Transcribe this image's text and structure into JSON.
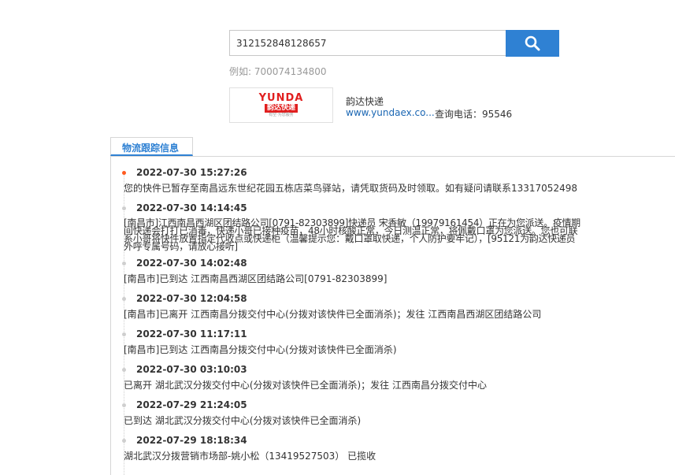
{
  "search": {
    "value": "312152848128657",
    "example_label": "例如:",
    "example_value": "700074134800"
  },
  "company": {
    "logo_text": "YUNDA",
    "logo_sub": "韵达快递",
    "logo_slogan": "有空·为您服务",
    "name": "韵达快递",
    "site": "www.yundaex.co...",
    "phone": "查询电话：95546"
  },
  "tab": {
    "label": "物流跟踪信息"
  },
  "colors": {
    "accent": "#2f81d3",
    "first_dot": "#ff5a1f"
  },
  "tracking": [
    {
      "time": "2022-07-30 15:27:26",
      "context": "您的快件已暂存至南昌远东世纪花园五栋店菜鸟驿站，请凭取货码及时领取。如有疑问请联系13317052498"
    },
    {
      "time": "2022-07-30 14:14:45",
      "context": "[南昌市]江西南昌西湖区团结路公司[0791-82303899]快递员 宋香敏（19979161454）正在为您派送。疫情期间快递会打打已消毒，快递小哥已接种疫苗，48小时核酸正常，今日测温正常，将佩戴口罩为您派送。您也可联系小哥将快件放置指定代收点或快递柜（温馨提示您：戴口罩取快递，个人防护要牢记），[95121为韵达快递员外呼专属号码，请放心接听]"
    },
    {
      "time": "2022-07-30 14:02:48",
      "context": "[南昌市]已到达 江西南昌西湖区团结路公司[0791-82303899]"
    },
    {
      "time": "2022-07-30 12:04:58",
      "context": "[南昌市]已离开 江西南昌分拨交付中心(分拨对该快件已全面消杀)；发往 江西南昌西湖区团结路公司"
    },
    {
      "time": "2022-07-30 11:17:11",
      "context": "[南昌市]已到达 江西南昌分拨交付中心(分拨对该快件已全面消杀)"
    },
    {
      "time": "2022-07-30 03:10:03",
      "context": "已离开 湖北武汉分拨交付中心(分拨对该快件已全面消杀)；发往 江西南昌分拨交付中心"
    },
    {
      "time": "2022-07-29 21:24:05",
      "context": "已到达 湖北武汉分拨交付中心(分拨对该快件已全面消杀)"
    },
    {
      "time": "2022-07-29 18:18:34",
      "context": "湖北武汉分拨营销市场部-姚小松（13419527503） 已揽收"
    }
  ]
}
